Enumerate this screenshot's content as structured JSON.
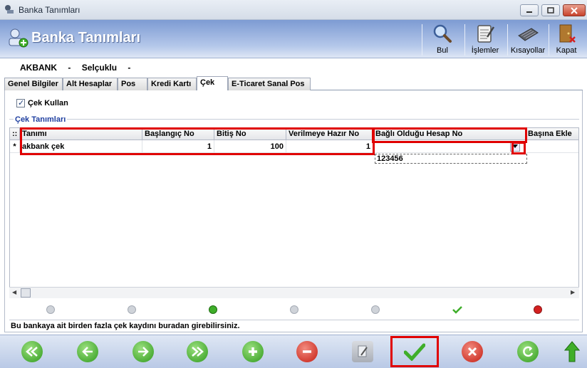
{
  "window": {
    "title": "Banka Tanımları"
  },
  "header": {
    "title": "Banka Tanımları",
    "toolbar": [
      {
        "label": "Bul",
        "icon": "magnifier-icon"
      },
      {
        "label": "İşlemler",
        "icon": "clipboard-icon"
      },
      {
        "label": "Kısayollar",
        "icon": "keyboard-icon"
      },
      {
        "label": "Kapat",
        "icon": "door-exit-icon"
      }
    ]
  },
  "bank": {
    "name": "AKBANK",
    "sep1": "-",
    "branch": "Selçuklu",
    "sep2": "-"
  },
  "tabs": [
    "Genel Bilgiler",
    "Alt Hesaplar",
    "Pos",
    "Kredi Kartı",
    "Çek",
    "E-Ticaret Sanal Pos"
  ],
  "active_tab": "Çek",
  "cek_kullan": {
    "label": "Çek Kullan",
    "checked": true
  },
  "section_title": "Çek Tanımları",
  "grid": {
    "columns": [
      "Tanımı",
      "Başlangıç No",
      "Bitiş No",
      "Verilmeye Hazır No",
      "Bağlı Olduğu Hesap No",
      "Başına Ekle"
    ],
    "row_marker": "*",
    "row": {
      "tanimi": "akbank çek",
      "baslangic": "1",
      "bitis": "100",
      "hazir": "1",
      "hesap": "",
      "basina_ekle": ""
    },
    "dropdown_option": "123456"
  },
  "status_text": "Bu bankaya ait birden fazla çek kaydını buradan girebilirsiniz.",
  "colors": {
    "header_top": "#7d9bd3",
    "highlight": "#e00000",
    "section_title": "#1f3fa0"
  }
}
